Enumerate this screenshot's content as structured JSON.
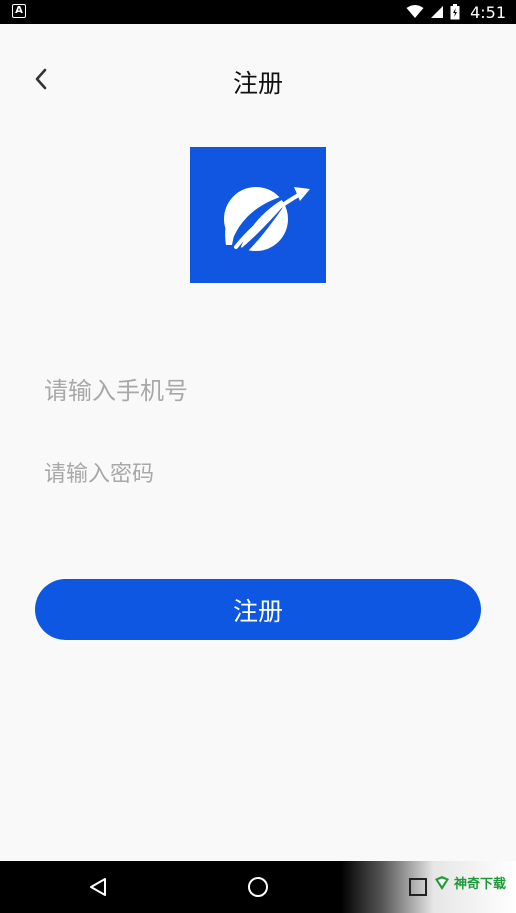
{
  "status_bar": {
    "left_icon_label": "A",
    "time": "4:51",
    "icons": [
      "wifi-icon",
      "signal-icon",
      "battery-icon"
    ]
  },
  "header": {
    "title": "注册",
    "back_icon": "chevron-left-icon"
  },
  "logo": {
    "icon": "globe-arrow-logo",
    "background_color": "#1056e0"
  },
  "form": {
    "phone_placeholder": "请输入手机号",
    "phone_value": "",
    "password_placeholder": "请输入密码",
    "password_value": "",
    "register_label": "注册"
  },
  "nav_bar": {
    "icons": [
      "back-triangle-icon",
      "home-circle-icon",
      "recents-square-icon"
    ]
  },
  "watermark": {
    "text": "神奇下载"
  },
  "colors": {
    "primary": "#0d57e3",
    "background": "#f9f9f9",
    "placeholder": "#a8a8a8"
  }
}
